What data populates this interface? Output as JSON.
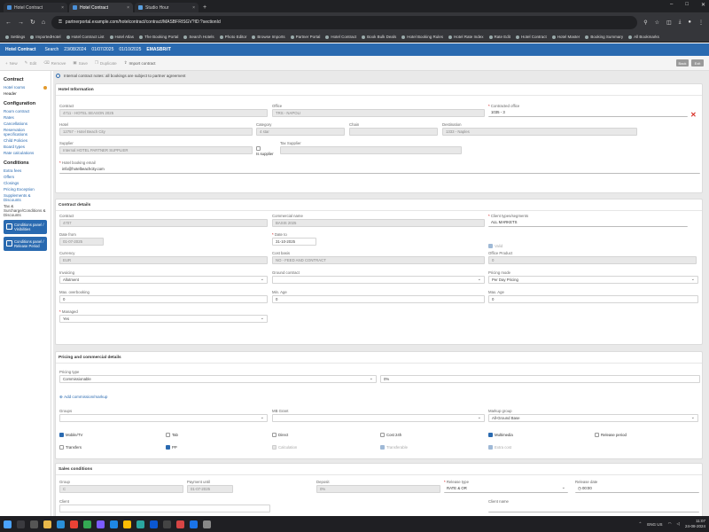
{
  "browser": {
    "tabs": [
      {
        "label": "Hotel Contract"
      },
      {
        "label": "Hotel Contract"
      },
      {
        "label": "Studio Hour"
      }
    ],
    "url": "partnerportal.example.com/hotelcontract/contract/MASBFRISGV?ID:?sectionId",
    "bookmarks": [
      "Settings",
      "ImportedHotel",
      "Hotel Contract List",
      "Hotel Atlas",
      "The Booking Portal",
      "Search Hotels",
      "Photo Editor",
      "Browse Imports",
      "Partner Portal",
      "Hotel Contract",
      "Book Bulk Deals",
      "Hotel Booking Rules",
      "Hotel Rate Index",
      "Rate Edit",
      "Hotel Contract",
      "Hotel Master",
      "Booking Summary",
      "All Bookmarks"
    ]
  },
  "app": {
    "title": "Hotel Contract",
    "crumbs": [
      "Search",
      "23/08/2024",
      "01/07/2025",
      "01/10/2025",
      "EMASBR/IT"
    ]
  },
  "toolbar": {
    "buttons": [
      "New",
      "Edit",
      "Remove",
      "Save",
      "Duplicate",
      "Import contract"
    ],
    "right": [
      "Back",
      "Exit"
    ]
  },
  "sidebar": {
    "sections": [
      {
        "heading": "Contract",
        "items": [
          "Hotel rooms",
          "Header"
        ]
      },
      {
        "heading": "Configuration",
        "items": [
          "Room contract",
          "Rates",
          "Cancellations",
          "Reservation specifications",
          "Child Policies",
          "Board types",
          "Rate calculations"
        ]
      },
      {
        "heading": "Conditions",
        "items": [
          "Extra fees",
          "Offers",
          "Closings",
          "Pricing Exception",
          "Supplements & Discounts",
          "Tax & Surcharge/Conditions & Discounts"
        ]
      }
    ],
    "buttons": [
      "Conditions panel / Visibilities",
      "Conditions panel / Release Period"
    ]
  },
  "notice": "Internal contract notes: all bookings are subject to partner agreement",
  "hotel": {
    "title": "Hotel Information",
    "contract_label": "Contract",
    "contract_value": "4711 - HOTEL SEASON 2025",
    "office_label": "Office",
    "office_value": "TRS - NAPOLI",
    "contracted_office_label": "Contracted office",
    "contracted_office_value": "1035 - 3",
    "hotel_label": "Hotel",
    "hotel_value": "12757 - Hotel Beach City",
    "category_label": "Category",
    "category_value": "4 star",
    "chain_label": "Chain",
    "chain_value": "",
    "destination_label": "Destination",
    "destination_value": "1333 - Naples",
    "supplier_label": "Supplier",
    "supplier_value": "Internal HOTEL PARTNER SUPPLIER",
    "is_supplier_label": "Is supplier",
    "tax_supplier_label": "Tax Supplier",
    "tax_supplier_value": "",
    "booking_email_label": "Hotel booking email",
    "booking_email_value": "info@hotelbeachcity.com"
  },
  "contract": {
    "title": "Contract details",
    "contract_label": "Contract",
    "contract_value": "4707",
    "commercial_label": "Commercial name",
    "commercial_value": "BASIS 2025",
    "client_types_label": "Client types/segments",
    "client_types_value": "ALL MARKETS",
    "date_from_label": "Date from",
    "date_from_value": "01-07-2025",
    "date_to_label": "Date to",
    "date_to_value": "31-10-2025",
    "valid_label": "Valid",
    "currency_label": "Currency",
    "currency_value": "EUR",
    "cost_basis_label": "Cost basis",
    "cost_basis_value": "NO - FEED AND CONTRACT",
    "office_product_label": "Office Product",
    "office_product_value": "0",
    "invoicing_label": "Invoicing",
    "invoicing_value": "Allotment",
    "ground_label": "Ground contract",
    "ground_value": "",
    "pricing_mode_label": "Pricing mode",
    "pricing_mode_value": "Per Day Pricing",
    "max_overbooking_label": "Max. overbooking",
    "max_overbooking_value": "0",
    "min_age_label": "Min. Age",
    "min_age_value": "0",
    "max_age_label": "Max. Age",
    "max_age_value": "0",
    "managed_label": "Managed",
    "managed_value": "Yes"
  },
  "pricing": {
    "title": "Pricing and commercial details",
    "pricing_type_label": "Pricing type",
    "pricing_type_value": "Commissionable",
    "pricing_extra_value": "0%",
    "add_link": "Add commission/markup",
    "groups_label": "Groups",
    "groups_value": "",
    "mb_label": "MB Grant",
    "mb_value": "",
    "markup_label": "Markup group",
    "markup_value": "All-Ground Base",
    "checks": [
      {
        "label": "Mobile/TV",
        "state": "on"
      },
      {
        "label": "Tab",
        "state": "off"
      },
      {
        "label": "Direct",
        "state": "off"
      },
      {
        "label": "Cost 24h",
        "state": "off"
      },
      {
        "label": "Multimedia",
        "state": "on"
      },
      {
        "label": "Release period",
        "state": "off"
      },
      {
        "label": "Transfers",
        "state": "off"
      },
      {
        "label": "PP",
        "state": "on"
      },
      {
        "label": "Calculation",
        "state": "dis"
      },
      {
        "label": "Transferable",
        "state": "dison"
      },
      {
        "label": "Extra cost",
        "state": "dison"
      }
    ]
  },
  "sales": {
    "title": "Sales conditions",
    "group_label": "Group",
    "group_value": "C",
    "payment_label": "Payment until",
    "payment_value": "01-07-2025",
    "deposit_label": "Deposit",
    "deposit_value": "0%",
    "release_type_label": "Release type",
    "release_type_value": "RATE & OR",
    "release_date_label": "Release date",
    "release_date_value": "00:00",
    "client_label": "Client",
    "client_value": "",
    "client_name_label": "Client name",
    "client_name_value": ""
  },
  "taskbar": {
    "lang": "ENG",
    "region": "US",
    "time": "11:07",
    "date": "24-08-2024"
  }
}
